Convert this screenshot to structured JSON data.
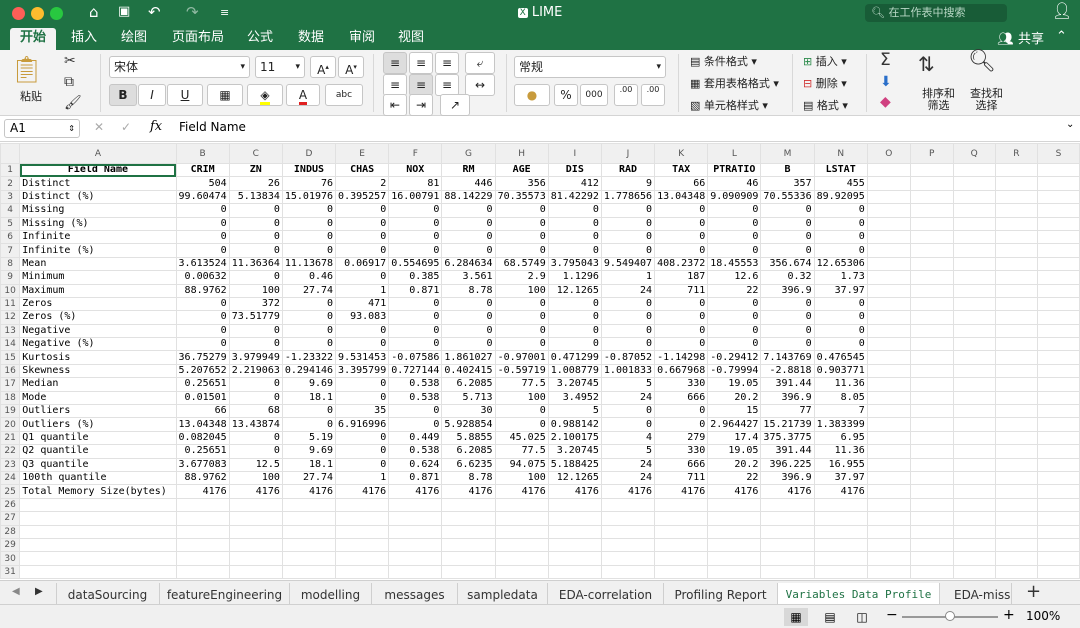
{
  "window": {
    "title": "LIME",
    "search_placeholder": "在工作表中搜索"
  },
  "menu": {
    "tabs": [
      "开始",
      "插入",
      "绘图",
      "页面布局",
      "公式",
      "数据",
      "审阅",
      "视图"
    ],
    "share": "共享"
  },
  "ribbon": {
    "paste": "粘贴",
    "font": "宋体",
    "size": "11",
    "bold": "B",
    "italic": "I",
    "underline": "U",
    "fontcolor_letter": "A",
    "abc": "abc",
    "number_format": "常规",
    "percent": "%",
    "thousands": "000",
    "inc_decimal": ".00",
    "dec_decimal": ".00",
    "cond_format": "条件格式",
    "table_format": "套用表格格式",
    "cell_style": "单元格样式",
    "insert": "插入",
    "delete": "删除",
    "format": "格式",
    "sort_filter": [
      "排序和",
      "筛选"
    ],
    "find_select": [
      "查找和",
      "选择"
    ]
  },
  "formula_bar": {
    "cell_ref": "A1",
    "fx": "fx",
    "value": "Field Name"
  },
  "grid": {
    "col_letters": [
      "A",
      "B",
      "C",
      "D",
      "E",
      "F",
      "G",
      "H",
      "I",
      "J",
      "K",
      "L",
      "M",
      "N",
      "O",
      "P",
      "Q",
      "R",
      "S"
    ],
    "header": [
      "Field Name",
      "CRIM",
      "ZN",
      "INDUS",
      "CHAS",
      "NOX",
      "RM",
      "AGE",
      "DIS",
      "RAD",
      "TAX",
      "PTRATIO",
      "B",
      "LSTAT"
    ],
    "rows": [
      [
        "Distinct",
        "504",
        "26",
        "76",
        "2",
        "81",
        "446",
        "356",
        "412",
        "9",
        "66",
        "46",
        "357",
        "455"
      ],
      [
        "Distinct (%)",
        "99.60474",
        "5.13834",
        "15.01976",
        "0.395257",
        "16.00791",
        "88.14229",
        "70.35573",
        "81.42292",
        "1.778656",
        "13.04348",
        "9.090909",
        "70.55336",
        "89.92095"
      ],
      [
        "Missing",
        "0",
        "0",
        "0",
        "0",
        "0",
        "0",
        "0",
        "0",
        "0",
        "0",
        "0",
        "0",
        "0"
      ],
      [
        "Missing (%)",
        "0",
        "0",
        "0",
        "0",
        "0",
        "0",
        "0",
        "0",
        "0",
        "0",
        "0",
        "0",
        "0"
      ],
      [
        "Infinite",
        "0",
        "0",
        "0",
        "0",
        "0",
        "0",
        "0",
        "0",
        "0",
        "0",
        "0",
        "0",
        "0"
      ],
      [
        "Infinite (%)",
        "0",
        "0",
        "0",
        "0",
        "0",
        "0",
        "0",
        "0",
        "0",
        "0",
        "0",
        "0",
        "0"
      ],
      [
        "Mean",
        "3.613524",
        "11.36364",
        "11.13678",
        "0.06917",
        "0.554695",
        "6.284634",
        "68.5749",
        "3.795043",
        "9.549407",
        "408.2372",
        "18.45553",
        "356.674",
        "12.65306"
      ],
      [
        "Minimum",
        "0.00632",
        "0",
        "0.46",
        "0",
        "0.385",
        "3.561",
        "2.9",
        "1.1296",
        "1",
        "187",
        "12.6",
        "0.32",
        "1.73"
      ],
      [
        "Maximum",
        "88.9762",
        "100",
        "27.74",
        "1",
        "0.871",
        "8.78",
        "100",
        "12.1265",
        "24",
        "711",
        "22",
        "396.9",
        "37.97"
      ],
      [
        "Zeros",
        "0",
        "372",
        "0",
        "471",
        "0",
        "0",
        "0",
        "0",
        "0",
        "0",
        "0",
        "0",
        "0"
      ],
      [
        "Zeros (%)",
        "0",
        "73.51779",
        "0",
        "93.083",
        "0",
        "0",
        "0",
        "0",
        "0",
        "0",
        "0",
        "0",
        "0"
      ],
      [
        "Negative",
        "0",
        "0",
        "0",
        "0",
        "0",
        "0",
        "0",
        "0",
        "0",
        "0",
        "0",
        "0",
        "0"
      ],
      [
        "Negative (%)",
        "0",
        "0",
        "0",
        "0",
        "0",
        "0",
        "0",
        "0",
        "0",
        "0",
        "0",
        "0",
        "0"
      ],
      [
        "Kurtosis",
        "36.75279",
        "3.979949",
        "-1.23322",
        "9.531453",
        "-0.07586",
        "1.861027",
        "-0.97001",
        "0.471299",
        "-0.87052",
        "-1.14298",
        "-0.29412",
        "7.143769",
        "0.476545"
      ],
      [
        "Skewness",
        "5.207652",
        "2.219063",
        "0.294146",
        "3.395799",
        "0.727144",
        "0.402415",
        "-0.59719",
        "1.008779",
        "1.001833",
        "0.667968",
        "-0.79994",
        "-2.8818",
        "0.903771"
      ],
      [
        "Median",
        "0.25651",
        "0",
        "9.69",
        "0",
        "0.538",
        "6.2085",
        "77.5",
        "3.20745",
        "5",
        "330",
        "19.05",
        "391.44",
        "11.36"
      ],
      [
        "Mode",
        "0.01501",
        "0",
        "18.1",
        "0",
        "0.538",
        "5.713",
        "100",
        "3.4952",
        "24",
        "666",
        "20.2",
        "396.9",
        "8.05"
      ],
      [
        "Outliers",
        "66",
        "68",
        "0",
        "35",
        "0",
        "30",
        "0",
        "5",
        "0",
        "0",
        "15",
        "77",
        "7"
      ],
      [
        "Outliers (%)",
        "13.04348",
        "13.43874",
        "0",
        "6.916996",
        "0",
        "5.928854",
        "0",
        "0.988142",
        "0",
        "0",
        "2.964427",
        "15.21739",
        "1.383399"
      ],
      [
        "Q1 quantile",
        "0.082045",
        "0",
        "5.19",
        "0",
        "0.449",
        "5.8855",
        "45.025",
        "2.100175",
        "4",
        "279",
        "17.4",
        "375.3775",
        "6.95"
      ],
      [
        "Q2 quantile",
        "0.25651",
        "0",
        "9.69",
        "0",
        "0.538",
        "6.2085",
        "77.5",
        "3.20745",
        "5",
        "330",
        "19.05",
        "391.44",
        "11.36"
      ],
      [
        "Q3 quantile",
        "3.677083",
        "12.5",
        "18.1",
        "0",
        "0.624",
        "6.6235",
        "94.075",
        "5.188425",
        "24",
        "666",
        "20.2",
        "396.225",
        "16.955"
      ],
      [
        "100th quantile",
        "88.9762",
        "100",
        "27.74",
        "1",
        "0.871",
        "8.78",
        "100",
        "12.1265",
        "24",
        "711",
        "22",
        "396.9",
        "37.97"
      ],
      [
        "Total Memory Size(bytes)",
        "4176",
        "4176",
        "4176",
        "4176",
        "4176",
        "4176",
        "4176",
        "4176",
        "4176",
        "4176",
        "4176",
        "4176",
        "4176"
      ]
    ],
    "row_numbers": [
      "1",
      "2",
      "3",
      "4",
      "5",
      "6",
      "7",
      "8",
      "9",
      "10",
      "11",
      "12",
      "13",
      "14",
      "15",
      "16",
      "17",
      "18",
      "19",
      "20",
      "21",
      "22",
      "23",
      "24",
      "25",
      "26",
      "27",
      "28",
      "29",
      "30",
      "31"
    ]
  },
  "sheets": [
    "dataSourcing",
    "featureEngineering",
    "modelling",
    "messages",
    "sampledata",
    "EDA-correlation",
    "Profiling Report",
    "Variables Data Profile",
    "EDA-miss"
  ],
  "status": {
    "zoom": "100%",
    "minus": "−",
    "plus": "+"
  },
  "colors": {
    "brand": "#1f7244",
    "selected": "#1f7244"
  }
}
